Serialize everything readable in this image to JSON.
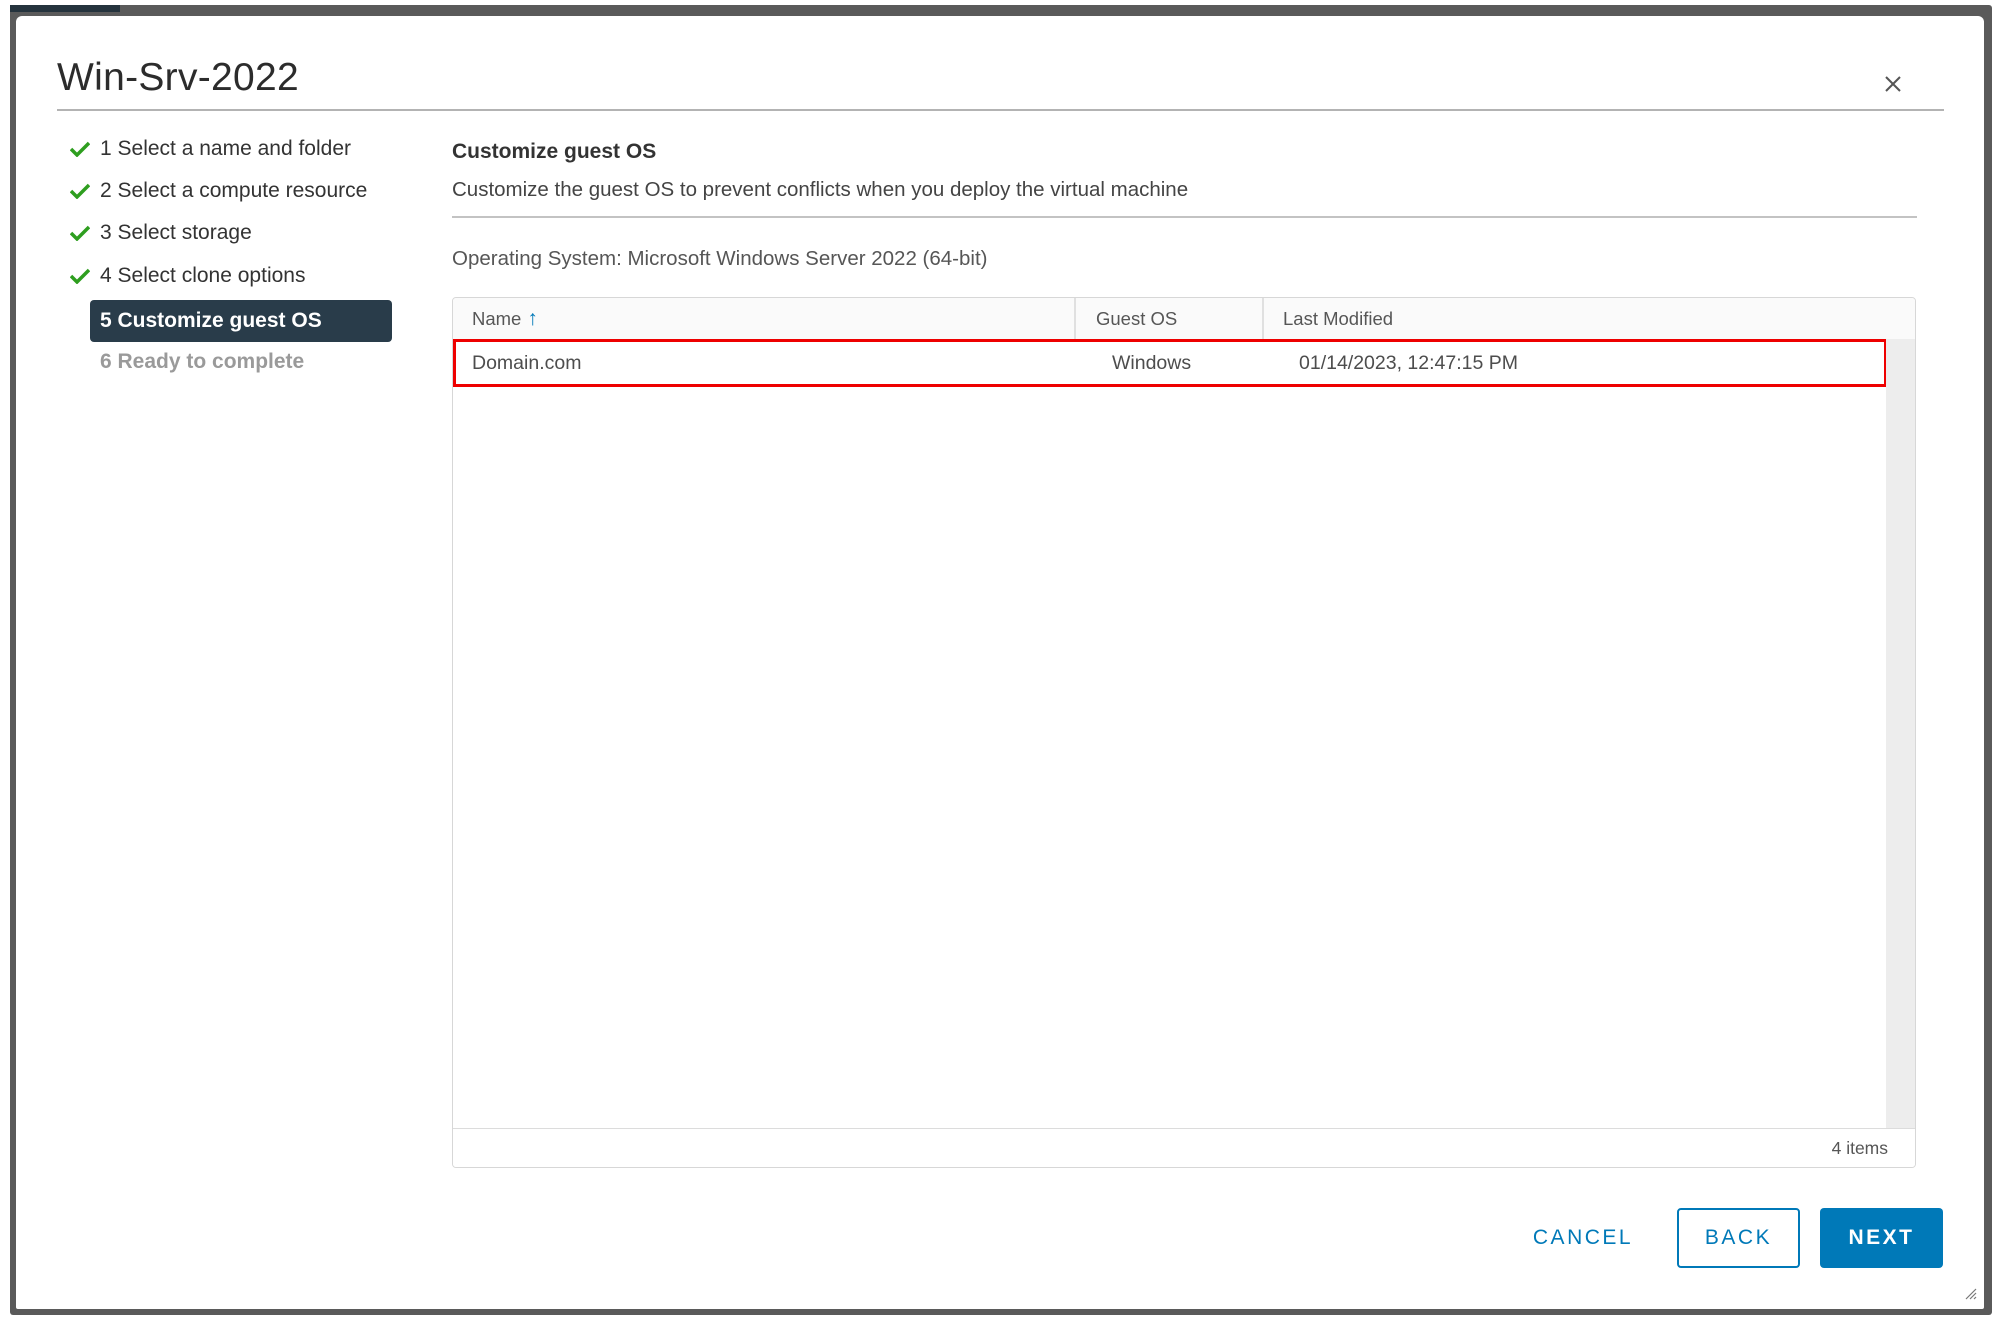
{
  "dialog": {
    "title": "Win-Srv-2022",
    "close_icon": "close-icon"
  },
  "steps": [
    {
      "label": "1 Select a name and folder",
      "state": "complete",
      "icon": "check-icon"
    },
    {
      "label": "2 Select a compute resource",
      "state": "complete",
      "icon": "check-icon"
    },
    {
      "label": "3 Select storage",
      "state": "complete",
      "icon": "check-icon"
    },
    {
      "label": "4 Select clone options",
      "state": "complete",
      "icon": "check-icon"
    },
    {
      "label": "5 Customize guest OS",
      "state": "active"
    },
    {
      "label": "6 Ready to complete",
      "state": "future"
    }
  ],
  "pane": {
    "heading": "Customize guest OS",
    "description": "Customize the guest OS to prevent conflicts when you deploy the virtual machine",
    "os_info": "Operating System: Microsoft Windows Server 2022 (64-bit)"
  },
  "grid": {
    "columns": [
      {
        "label": "Name",
        "sort": "ascending",
        "sort_icon": "arrow-up-icon"
      },
      {
        "label": "Guest OS"
      },
      {
        "label": "Last Modified"
      }
    ],
    "rows": [
      {
        "name": "Domain.com",
        "guest_os": "Windows",
        "last_modified": "01/14/2023, 12:47:15 PM",
        "highlighted": true
      }
    ],
    "footer": "4 items"
  },
  "buttons": {
    "cancel": "CANCEL",
    "back": "BACK",
    "next": "NEXT"
  },
  "colors": {
    "accent": "#0079b8",
    "active_step_bg": "#293c4a",
    "check": "#2e9e1f",
    "highlight_border": "#ee0000"
  }
}
